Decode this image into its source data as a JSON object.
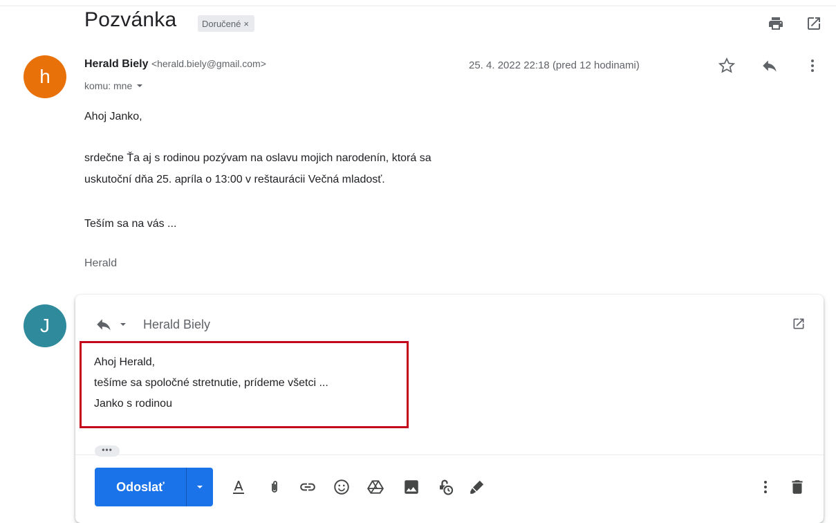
{
  "email": {
    "subject": "Pozvánka",
    "label": "Doručené",
    "label_remove": "×",
    "sender_initial": "h",
    "sender_name": "Herald Biely",
    "sender_email": "<herald.biely@gmail.com>",
    "recipient_line": "komu: mne",
    "date": "25. 4. 2022 22:18 (pred 12 hodinami)",
    "body": [
      "Ahoj Janko,",
      "srdečne Ťa aj s rodinou pozývam na oslavu mojich narodenín, ktorá sa",
      "uskutoční dňa 25. apríla o 13:00 v reštaurácii Večná mladosť.",
      "Teším sa na vás ..."
    ],
    "signature": "Herald"
  },
  "reply": {
    "user_initial": "J",
    "to": "Herald Biely",
    "draft_lines": [
      "Ahoj Herald,",
      "tešíme sa spoločné stretnutie, prídeme všetci ...",
      "Janko s rodinou"
    ],
    "trimmed_content": "•••",
    "send_label": "Odoslať"
  },
  "icons": {
    "header": [
      "print-icon",
      "open-in-new-window-icon"
    ],
    "message": [
      "star-icon",
      "reply-icon",
      "more-vert-icon"
    ],
    "toolbar": [
      "format-text-icon",
      "attach-file-icon",
      "insert-link-icon",
      "insert-emoji-icon",
      "google-drive-icon",
      "insert-photo-icon",
      "confidential-mode-icon",
      "insert-signature-icon",
      "more-options-icon",
      "discard-draft-icon"
    ]
  },
  "colors": {
    "sender_avatar": "#e8710a",
    "user_avatar": "#2f8a9c",
    "send_button": "#1a73e8",
    "highlight_box": "#c5051c"
  }
}
